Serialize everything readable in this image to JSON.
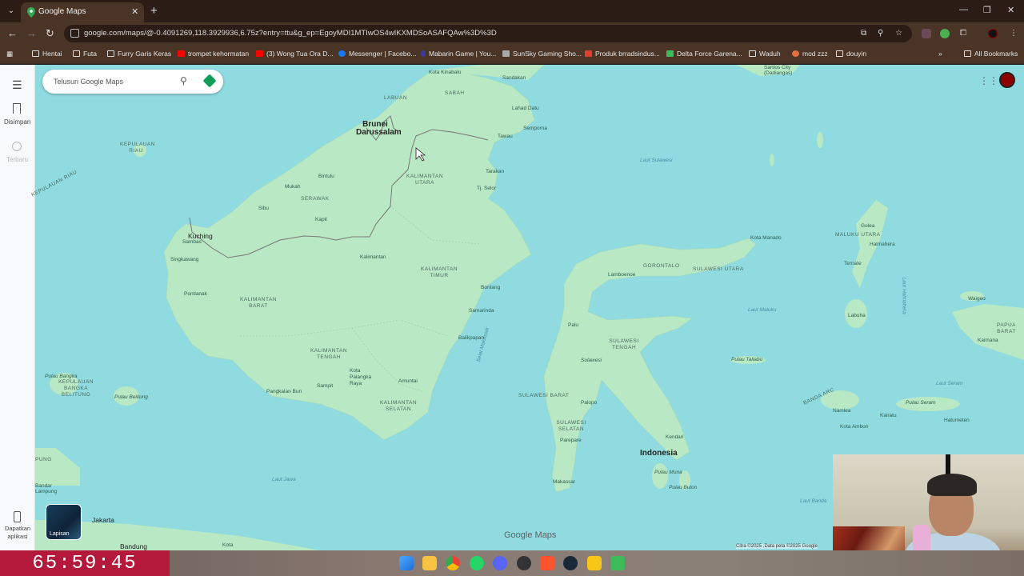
{
  "browser": {
    "tab_title": "Google Maps",
    "url": "google.com/maps/@-0.4091269,118.3929936,6.75z?entry=ttu&g_ep=EgoyMDI1MTIwOS4wIKXMDSoASAFQAw%3D%3D",
    "bookmarks": [
      {
        "label": "Hentai",
        "icon": "folder-icon"
      },
      {
        "label": "Futa",
        "icon": "folder-icon"
      },
      {
        "label": "Furry Garis Keras",
        "icon": "folder-icon"
      },
      {
        "label": "trompet kehormatan",
        "icon": "youtube-icon"
      },
      {
        "label": "(3) Wong Tua Ora D...",
        "icon": "youtube-icon"
      },
      {
        "label": "Messenger | Facebo...",
        "icon": "facebook-icon"
      },
      {
        "label": "Mabarin Game | You...",
        "icon": "site-icon"
      },
      {
        "label": "SunSky Gaming Sho...",
        "icon": "site-icon"
      },
      {
        "label": "Produk brradsindus...",
        "icon": "shop-icon"
      },
      {
        "label": "Delta Force Garena...",
        "icon": "game-icon"
      },
      {
        "label": "Waduh",
        "icon": "folder-icon"
      },
      {
        "label": "mod zzz",
        "icon": "site-icon"
      },
      {
        "label": "douyin",
        "icon": "folder-icon"
      }
    ],
    "all_bookmarks": "All Bookmarks"
  },
  "maps": {
    "search_placeholder": "Telusuri Google Maps",
    "saved_label": "Disimpan",
    "recent_label": "Terbaru",
    "get_app_label": "Dapatkan aplikasi",
    "layers_label": "Lapisan",
    "logo": "Google Maps",
    "attribution": "Citra ©2025 ,Data peta ©2025 Google",
    "labels": {
      "brunei": "Brunei Darussalam",
      "kuching": "Kuching",
      "indonesia": "Indonesia",
      "jakarta": "Jakarta",
      "bandung": "Bandung",
      "sabah": "SABAH",
      "labuan": "LABUAN",
      "sarawak": "SERAWAK",
      "kaltara": "KALIMANTAN UTARA",
      "kaltim": "KALIMANTAN TIMUR",
      "kalbar": "KALIMANTAN BARAT",
      "kalteng": "KALIMANTAN TENGAH",
      "kalsel": "KALIMANTAN SELATAN",
      "sulteng": "SULAWESI TENGAH",
      "sulbar": "SULAWESI BARAT",
      "sulsel": "SULAWESI SELATAN",
      "sulut": "SULAWESI UTARA",
      "gorontalo": "GORONTALO",
      "malut": "MALUKU UTARA",
      "papbar": "PAPUA BARAT",
      "babel": "KEPULAUAN BANGKA BELITUNG",
      "kepriau": "KEPULAUAN RIAU",
      "riau_arc": "KEPULAUAN RIAU",
      "laut_sulawesi": "Laut Sulawesi",
      "laut_maluku": "Laut Maluku",
      "laut_jawa": "Laut Jawa",
      "laut_banda": "Laut Banda",
      "laut_seram": "Laut Seram",
      "selat_makassar": "Selat Makassar",
      "banda_arc": "BANDA ARC",
      "kota_kinabalu": "Kota Kinabalu",
      "sandakan": "Sandakan",
      "lahad_datu": "Lahad Datu",
      "semporna": "Semporna",
      "tawau": "Tawau",
      "tarakan": "Tarakan",
      "tj_selor": "Tj. Selor",
      "bintulu": "Bintulu",
      "mukah": "Mukah",
      "sibu": "Sibu",
      "kapit": "Kapit",
      "sambas": "Sambas",
      "singkawang": "Singkawang",
      "pontianak": "Pontianak",
      "kalimantan": "Kalimantan",
      "bontang": "Bontang",
      "samarinda": "Samarinda",
      "balikpapan": "Balikpapan",
      "palangka": "Kota Palangka Raya",
      "sampit": "Sampit",
      "pangkalan_bun": "Pangkalan Bun",
      "amuntai": "Amuntai",
      "palu": "Palu",
      "palopo": "Palopo",
      "parepare": "Parepare",
      "makassar": "Makassar",
      "kendari": "Kendari",
      "lamboenoe": "Lamboenoe",
      "kota_manado": "Kota Manado",
      "golea": "Golea",
      "halmahera": "Halmahera",
      "ternate": "Ternate",
      "labuha": "Labuha",
      "waigeo": "Waigeo",
      "kaimana": "Kaimana",
      "namlea": "Namlea",
      "kairatu": "Kairatu",
      "kota_ambon": "Kota Ambon",
      "pulau_seram": "Pulau Seram",
      "hatumeten": "Hatumeten",
      "pulau_taliabu": "Pulau Taliabu",
      "pulau_muna": "Pulau Muna",
      "pulau_buton": "Pulau Buton",
      "pulau_bangka": "Pulau Bangka",
      "pulau_belitung": "Pulau Belitung",
      "santos": "Santos City (Dadiangas)",
      "laut_halmahera": "Laut Halmahera",
      "sulawesi": "Sulawesi",
      "lampung": "PUNG",
      "bandar_lampung": "Bandar Lampung",
      "kota": "Kota"
    }
  },
  "timer": "65:59:45",
  "colors": {
    "water": "#8fdbe0",
    "land": "#b9e8c4",
    "accent": "#b4183a"
  }
}
